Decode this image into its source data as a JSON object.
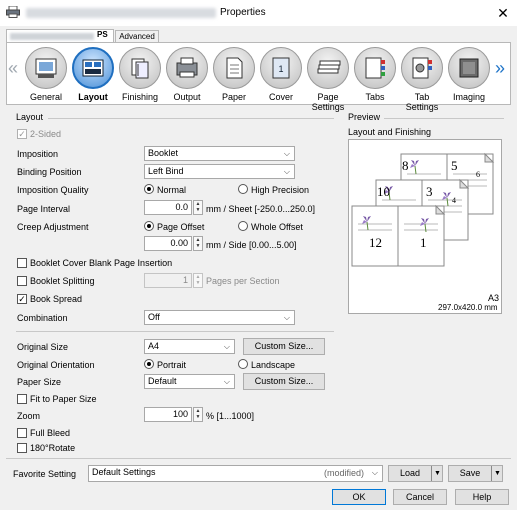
{
  "window": {
    "title": "Properties",
    "close_glyph": "✕"
  },
  "tabs": [
    {
      "label": "PS"
    },
    {
      "label": "Advanced"
    }
  ],
  "functions": [
    {
      "label": "General",
      "icon": "general-icon"
    },
    {
      "label": "Layout",
      "icon": "layout-icon",
      "selected": true
    },
    {
      "label": "Finishing",
      "icon": "finishing-icon"
    },
    {
      "label": "Output",
      "icon": "output-icon"
    },
    {
      "label": "Paper",
      "icon": "paper-icon"
    },
    {
      "label": "Cover",
      "icon": "cover-icon"
    },
    {
      "label": "Page Settings",
      "icon": "page-settings-icon"
    },
    {
      "label": "Tabs",
      "icon": "tabs-icon"
    },
    {
      "label": "Tab Settings",
      "icon": "tab-settings-icon"
    },
    {
      "label": "Imaging",
      "icon": "imaging-icon"
    }
  ],
  "layout": {
    "group_title": "Layout",
    "two_sided": "2-Sided",
    "imposition": {
      "label": "Imposition",
      "value": "Booklet"
    },
    "binding_position": {
      "label": "Binding Position",
      "value": "Left Bind"
    },
    "imposition_quality": {
      "label": "Imposition Quality",
      "opt1": "Normal",
      "opt2": "High Precision"
    },
    "page_interval": {
      "label": "Page Interval",
      "value": "0.0",
      "unit": "mm / Sheet [-250.0...250.0]"
    },
    "creep": {
      "label": "Creep Adjustment",
      "opt1": "Page Offset",
      "opt2": "Whole Offset",
      "value": "0.00",
      "unit": "mm / Side [0.00...5.00]"
    },
    "cover_blank": "Booklet Cover Blank Page Insertion",
    "splitting": {
      "label": "Booklet Splitting",
      "value": "1",
      "unit": "Pages per Section"
    },
    "book_spread": "Book Spread",
    "combination": {
      "label": "Combination",
      "value": "Off"
    },
    "original_size": {
      "label": "Original Size",
      "value": "A4",
      "button": "Custom Size..."
    },
    "orientation": {
      "label": "Original Orientation",
      "opt1": "Portrait",
      "opt2": "Landscape"
    },
    "paper_size": {
      "label": "Paper Size",
      "value": "Default",
      "button": "Custom Size..."
    },
    "fit_to_paper": "Fit to Paper Size",
    "zoom": {
      "label": "Zoom",
      "value": "100",
      "unit": "% [1...1000]"
    },
    "full_bleed": "Full Bleed",
    "rotate": "180°Rotate"
  },
  "preview": {
    "title": "Preview",
    "subtitle": "Layout and Finishing",
    "pages": [
      "8",
      "5",
      "6",
      "10",
      "3",
      "4",
      "12",
      "1"
    ],
    "paper": "A3",
    "paper_dims": "297.0x420.0 mm"
  },
  "favorite": {
    "label": "Favorite Setting",
    "value": "Default Settings",
    "modified": "(modified)",
    "load": "Load",
    "save": "Save"
  },
  "footer": {
    "ok": "OK",
    "cancel": "Cancel",
    "help": "Help"
  }
}
